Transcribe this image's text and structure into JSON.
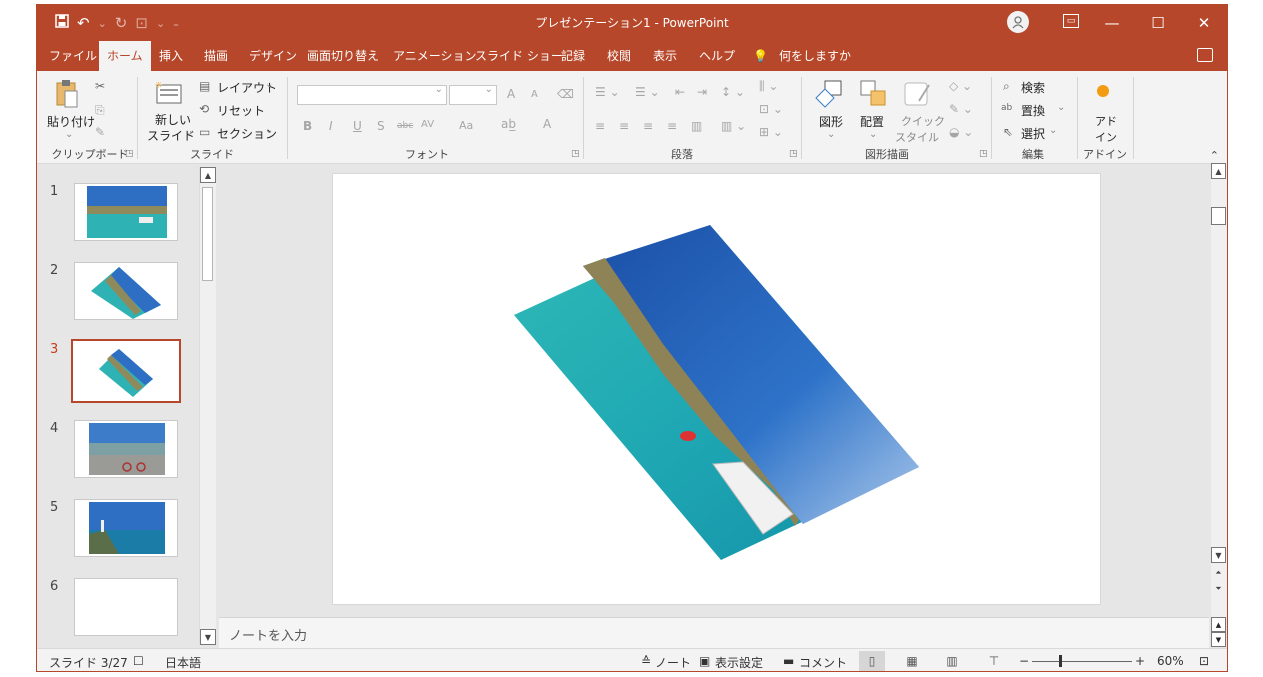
{
  "window": {
    "title": "プレゼンテーション1  -  PowerPoint",
    "controls": {
      "minimize": "—",
      "maximize": "☐",
      "close": "✕"
    }
  },
  "qat": {
    "save_icon": "save-icon",
    "undo": "↶",
    "redo": "↻"
  },
  "tabs": [
    {
      "label": "ファイル"
    },
    {
      "label": "ホーム"
    },
    {
      "label": "挿入"
    },
    {
      "label": "描画"
    },
    {
      "label": "デザイン"
    },
    {
      "label": "画面切り替え"
    },
    {
      "label": "アニメーション"
    },
    {
      "label": "スライド ショー"
    },
    {
      "label": "記録"
    },
    {
      "label": "校閲"
    },
    {
      "label": "表示"
    },
    {
      "label": "ヘルプ"
    },
    {
      "label": "何をしますか"
    }
  ],
  "ribbon": {
    "clipboard": {
      "paste": "貼り付け",
      "group": "クリップボード"
    },
    "slides": {
      "new_slide_1": "新しい",
      "new_slide_2": "スライド",
      "layout": "レイアウト",
      "reset": "リセット",
      "section": "セクション",
      "group": "スライド"
    },
    "font": {
      "group": "フォント",
      "bold": "B",
      "italic": "I",
      "underline": "U",
      "shadow": "S",
      "strike": "abc",
      "spacing": "AV",
      "case": "Aa",
      "grow": "A",
      "shrink": "A",
      "color": "A"
    },
    "paragraph": {
      "group": "段落"
    },
    "drawing": {
      "shapes": "図形",
      "arrange": "配置",
      "quick_1": "クイック",
      "quick_2": "スタイル",
      "group": "図形描画"
    },
    "editing": {
      "find": "検索",
      "replace": "置換",
      "select": "選択",
      "group": "編集"
    },
    "addins": {
      "label_1": "アド",
      "label_2": "イン",
      "group": "アドイン"
    }
  },
  "slides": [
    {
      "num": "1"
    },
    {
      "num": "2"
    },
    {
      "num": "3"
    },
    {
      "num": "4"
    },
    {
      "num": "5"
    },
    {
      "num": "6"
    }
  ],
  "notes_placeholder": "ノートを入力",
  "status": {
    "slide_info": "スライド 3/27",
    "language": "日本語",
    "notes": "ノート",
    "display_settings": "表示設定",
    "comments": "コメント",
    "zoom_minus": "−",
    "zoom_plus": "+",
    "zoom": "60%"
  },
  "colors": {
    "accent": "#b7472a",
    "selected_number": "#c43e1c"
  }
}
